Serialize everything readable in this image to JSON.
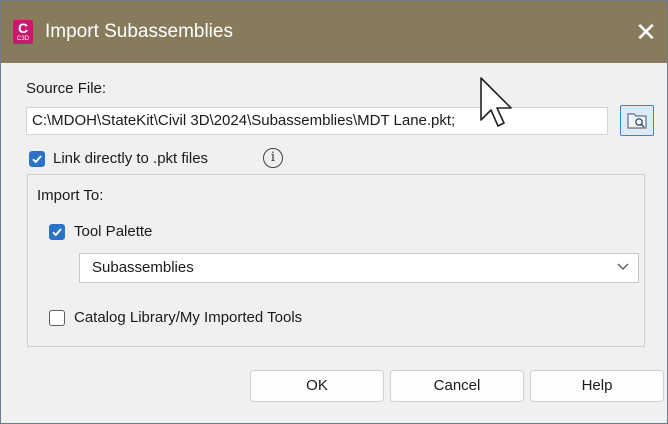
{
  "window": {
    "title": "Import Subassemblies",
    "app_icon_letter": "C",
    "app_icon_version": "C3D",
    "close_glyph": "✕"
  },
  "source_file": {
    "label": "Source File:",
    "value": "C:\\MDOH\\StateKit\\Civil 3D\\2024\\Subassemblies\\MDT Lane.pkt;"
  },
  "link_directly": {
    "label": "Link directly to .pkt files",
    "checked": true,
    "info_glyph": "i"
  },
  "import_to": {
    "label": "Import To:",
    "tool_palette": {
      "label": "Tool Palette",
      "checked": true
    },
    "palette_select": {
      "value": "Subassemblies"
    },
    "catalog_library": {
      "label": "Catalog Library/My Imported Tools",
      "checked": false
    }
  },
  "buttons": {
    "ok": "OK",
    "cancel": "Cancel",
    "help": "Help"
  },
  "colors": {
    "titlebar": "#877b5c",
    "accent": "#2b73c9",
    "app_icon": "#c8196e"
  }
}
